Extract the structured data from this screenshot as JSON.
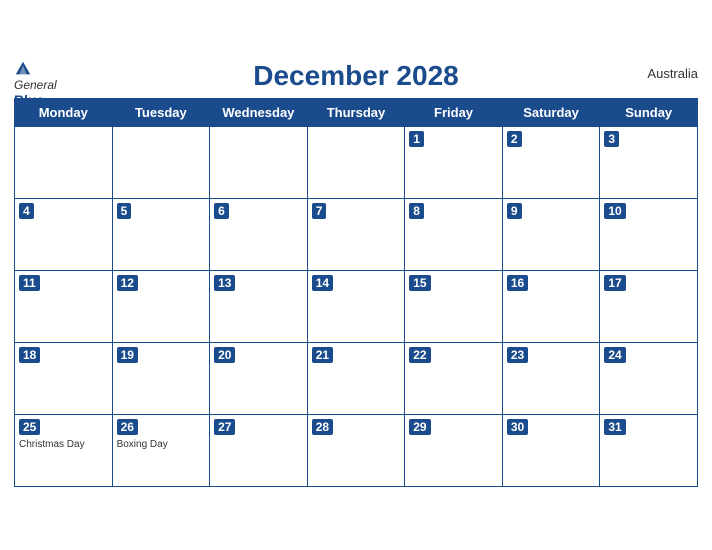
{
  "header": {
    "logo_general": "General",
    "logo_blue": "Blue",
    "title": "December 2028",
    "country": "Australia"
  },
  "days_of_week": [
    "Monday",
    "Tuesday",
    "Wednesday",
    "Thursday",
    "Friday",
    "Saturday",
    "Sunday"
  ],
  "weeks": [
    [
      {
        "day": "",
        "holiday": ""
      },
      {
        "day": "",
        "holiday": ""
      },
      {
        "day": "",
        "holiday": ""
      },
      {
        "day": "",
        "holiday": ""
      },
      {
        "day": "1",
        "holiday": ""
      },
      {
        "day": "2",
        "holiday": ""
      },
      {
        "day": "3",
        "holiday": ""
      }
    ],
    [
      {
        "day": "4",
        "holiday": ""
      },
      {
        "day": "5",
        "holiday": ""
      },
      {
        "day": "6",
        "holiday": ""
      },
      {
        "day": "7",
        "holiday": ""
      },
      {
        "day": "8",
        "holiday": ""
      },
      {
        "day": "9",
        "holiday": ""
      },
      {
        "day": "10",
        "holiday": ""
      }
    ],
    [
      {
        "day": "11",
        "holiday": ""
      },
      {
        "day": "12",
        "holiday": ""
      },
      {
        "day": "13",
        "holiday": ""
      },
      {
        "day": "14",
        "holiday": ""
      },
      {
        "day": "15",
        "holiday": ""
      },
      {
        "day": "16",
        "holiday": ""
      },
      {
        "day": "17",
        "holiday": ""
      }
    ],
    [
      {
        "day": "18",
        "holiday": ""
      },
      {
        "day": "19",
        "holiday": ""
      },
      {
        "day": "20",
        "holiday": ""
      },
      {
        "day": "21",
        "holiday": ""
      },
      {
        "day": "22",
        "holiday": ""
      },
      {
        "day": "23",
        "holiday": ""
      },
      {
        "day": "24",
        "holiday": ""
      }
    ],
    [
      {
        "day": "25",
        "holiday": "Christmas Day"
      },
      {
        "day": "26",
        "holiday": "Boxing Day"
      },
      {
        "day": "27",
        "holiday": ""
      },
      {
        "day": "28",
        "holiday": ""
      },
      {
        "day": "29",
        "holiday": ""
      },
      {
        "day": "30",
        "holiday": ""
      },
      {
        "day": "31",
        "holiday": ""
      }
    ]
  ]
}
